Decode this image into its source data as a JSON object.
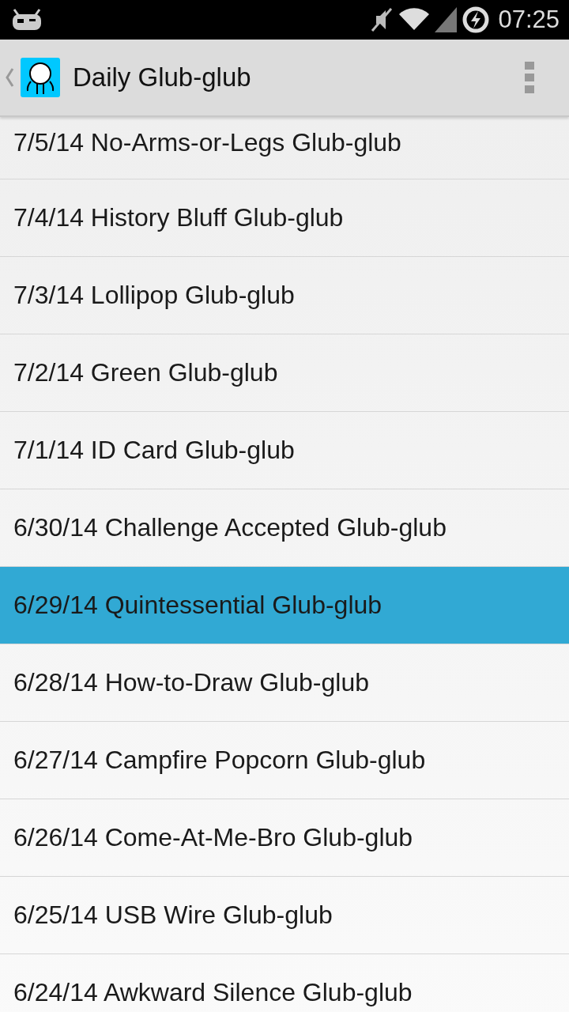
{
  "status_bar": {
    "time": "07:25"
  },
  "action_bar": {
    "title": "Daily Glub-glub"
  },
  "items": [
    {
      "label": "7/5/14 No-Arms-or-Legs Glub-glub",
      "selected": false
    },
    {
      "label": "7/4/14 History Bluff Glub-glub",
      "selected": false
    },
    {
      "label": "7/3/14 Lollipop Glub-glub",
      "selected": false
    },
    {
      "label": "7/2/14 Green Glub-glub",
      "selected": false
    },
    {
      "label": "7/1/14 ID Card Glub-glub",
      "selected": false
    },
    {
      "label": "6/30/14 Challenge Accepted Glub-glub",
      "selected": false
    },
    {
      "label": "6/29/14 Quintessential Glub-glub",
      "selected": true
    },
    {
      "label": "6/28/14 How-to-Draw Glub-glub",
      "selected": false
    },
    {
      "label": "6/27/14 Campfire Popcorn Glub-glub",
      "selected": false
    },
    {
      "label": "6/26/14 Come-At-Me-Bro Glub-glub",
      "selected": false
    },
    {
      "label": "6/25/14 USB Wire Glub-glub",
      "selected": false
    },
    {
      "label": "6/24/14 Awkward Silence Glub-glub",
      "selected": false
    }
  ]
}
